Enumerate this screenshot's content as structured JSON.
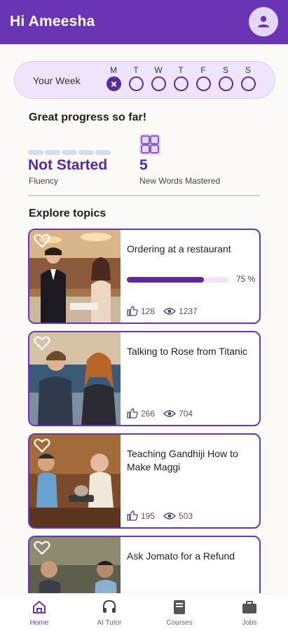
{
  "header": {
    "greeting": "Hi Ameesha",
    "avatar_icon": "person-icon"
  },
  "week": {
    "label": "Your Week",
    "days": [
      {
        "letter": "M",
        "done": true
      },
      {
        "letter": "T",
        "done": false
      },
      {
        "letter": "W",
        "done": false
      },
      {
        "letter": "T",
        "done": false
      },
      {
        "letter": "F",
        "done": false
      },
      {
        "letter": "S",
        "done": false
      },
      {
        "letter": "S",
        "done": false
      }
    ]
  },
  "progress": {
    "heading": "Great progress so far!",
    "fluency_value": "Not Started",
    "fluency_label": "Fluency",
    "words_value": "5",
    "words_label": "New Words Mastered"
  },
  "explore": {
    "heading": "Explore topics",
    "topics": [
      {
        "title": "Ordering at a restaurant",
        "progress_percent": 75,
        "progress_text": "75 %",
        "likes": "128",
        "views": "1237"
      },
      {
        "title": "Talking to Rose from Titanic",
        "likes": "266",
        "views": "704"
      },
      {
        "title": "Teaching Gandhiji How to Make Maggi",
        "likes": "195",
        "views": "503"
      },
      {
        "title": "Ask Jomato for a Refund"
      }
    ]
  },
  "nav": {
    "items": [
      {
        "label": "Home",
        "icon": "home-icon",
        "active": true
      },
      {
        "label": "AI Tutor",
        "icon": "headset-icon",
        "active": false
      },
      {
        "label": "Courses",
        "icon": "book-icon",
        "active": false
      },
      {
        "label": "Jobs",
        "icon": "briefcase-icon",
        "active": false
      }
    ]
  },
  "colors": {
    "brand": "#6a35b4",
    "accent_dark": "#5a2b9c",
    "week_bg": "#efe4fb"
  }
}
